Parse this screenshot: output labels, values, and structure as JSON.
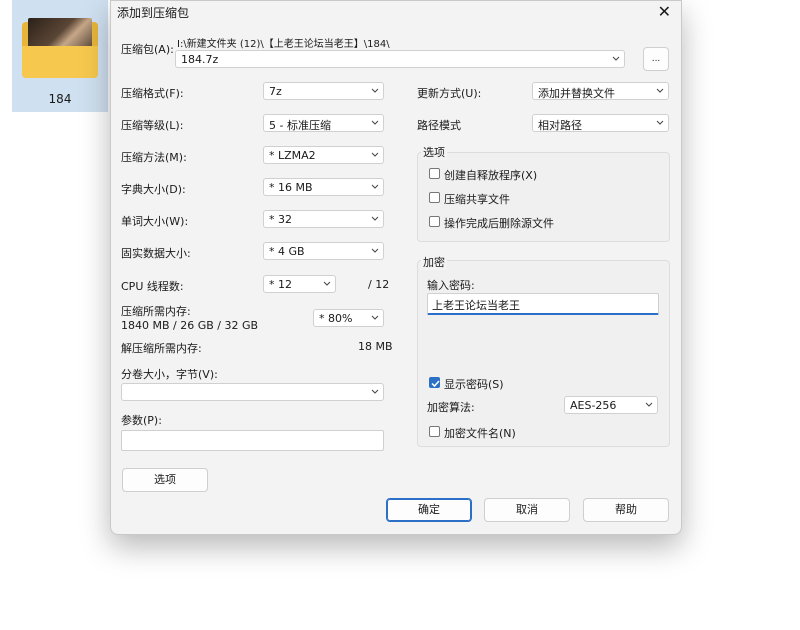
{
  "desktop": {
    "folder_label": "184"
  },
  "dialog": {
    "title": "添加到压缩包",
    "close_glyph": "✕",
    "archive": {
      "label": "压缩包(A):",
      "path": "I:\\新建文件夹 (12)\\【上老王论坛当老王】\\184\\",
      "name": "184.7z",
      "browse_label": "..."
    },
    "left": {
      "format": {
        "label": "压缩格式(F):",
        "value": "7z"
      },
      "level": {
        "label": "压缩等级(L):",
        "value": "5 - 标准压缩"
      },
      "method": {
        "label": "压缩方法(M):",
        "value": "*  LZMA2"
      },
      "dict": {
        "label": "字典大小(D):",
        "value": "*  16 MB"
      },
      "word": {
        "label": "单词大小(W):",
        "value": "*  32"
      },
      "solid": {
        "label": "固实数据大小:",
        "value": "*  4 GB"
      },
      "cpu": {
        "label": "CPU 线程数:",
        "value": "*  12",
        "total": "/ 12"
      },
      "memory": {
        "label": "压缩所需内存:",
        "detail": "1840 MB / 26 GB / 32 GB",
        "percent": "*  80%"
      },
      "decompress_mem": {
        "label": "解压缩所需内存:",
        "value": "18 MB"
      },
      "volume": {
        "label": "分卷大小，字节(V):",
        "value": ""
      },
      "params": {
        "label": "参数(P):",
        "value": ""
      },
      "options_button": "选项"
    },
    "right": {
      "update": {
        "label": "更新方式(U):",
        "value": "添加并替换文件"
      },
      "path_mode": {
        "label": "路径模式",
        "value": "相对路径"
      },
      "options_group": {
        "title": "选项",
        "items": [
          {
            "label": "创建自释放程序(X)",
            "checked": false
          },
          {
            "label": "压缩共享文件",
            "checked": false
          },
          {
            "label": "操作完成后删除源文件",
            "checked": false
          }
        ]
      },
      "encryption": {
        "title": "加密",
        "password_label": "输入密码:",
        "password_value": "上老王论坛当老王",
        "show_password": {
          "label": "显示密码(S)",
          "checked": true
        },
        "method_label": "加密算法:",
        "method_value": "AES-256",
        "encrypt_names": {
          "label": "加密文件名(N)",
          "checked": false
        }
      }
    },
    "buttons": {
      "ok": "确定",
      "cancel": "取消",
      "help": "帮助"
    }
  }
}
